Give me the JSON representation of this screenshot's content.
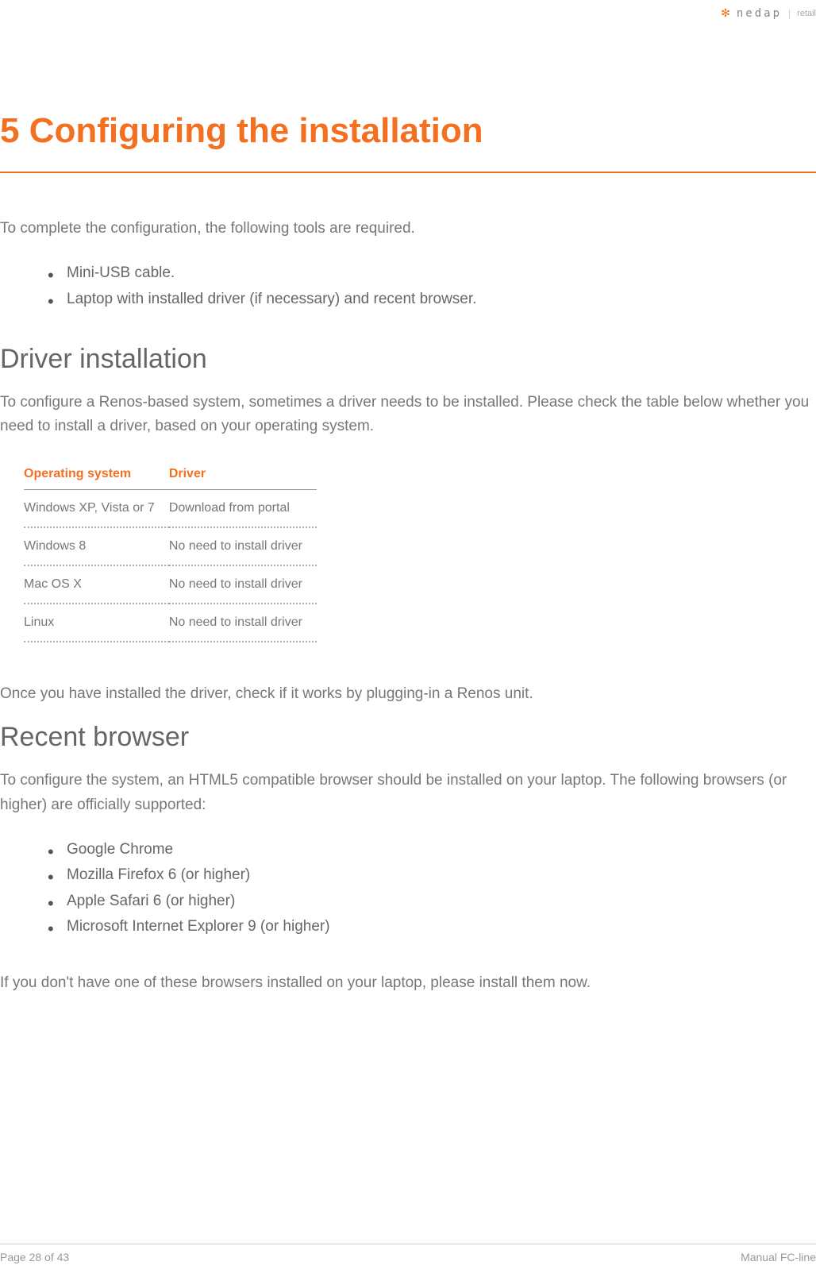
{
  "header": {
    "logo_text": "nedap",
    "logo_suffix": "retail"
  },
  "title": "5 Configuring the installation",
  "intro": "To complete the configuration, the following tools are required.",
  "tools": [
    "Mini-USB cable.",
    "Laptop with installed driver (if necessary) and recent browser."
  ],
  "section_driver": {
    "heading": "Driver installation",
    "intro": "To configure a Renos-based system, sometimes a driver needs to be installed. Please check the table below whether you need to install a driver, based on your operating system.",
    "table": {
      "headers": [
        "Operating system",
        "Driver"
      ],
      "rows": [
        [
          "Windows XP, Vista or 7",
          "Download from portal"
        ],
        [
          "Windows 8",
          "No need to install driver"
        ],
        [
          "Mac OS X",
          "No need to install driver"
        ],
        [
          "Linux",
          "No need to install driver"
        ]
      ]
    },
    "outro": "Once you have installed the driver, check if it works by plugging-in a Renos unit."
  },
  "section_browser": {
    "heading": "Recent browser",
    "intro": "To configure the system, an HTML5 compatible browser should be installed on your laptop. The following browsers (or higher) are officially supported:",
    "browsers": [
      "Google Chrome",
      "Mozilla Firefox 6 (or higher)",
      "Apple Safari 6 (or higher)",
      "Microsoft Internet Explorer 9 (or higher)"
    ],
    "outro": "If you don't have one of these browsers installed on your laptop, please install them now."
  },
  "footer": {
    "page": "Page 28 of 43",
    "manual": "Manual FC-line"
  }
}
